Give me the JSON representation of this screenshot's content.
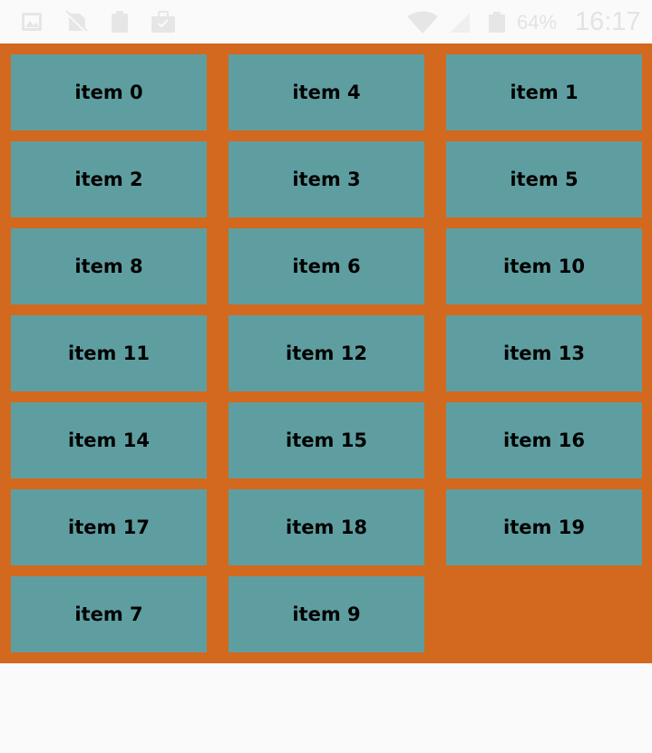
{
  "status_bar": {
    "icons_left": [
      "gallery-icon",
      "no-sim-icon",
      "clipboard-icon",
      "briefcase-icon"
    ],
    "icons_right": [
      "wifi-icon",
      "signal-icon",
      "battery-icon"
    ],
    "battery": "64%",
    "time": "16:17"
  },
  "colors": {
    "background": "#d2691e",
    "item": "#5f9ea0",
    "text": "#000000"
  },
  "items": [
    "item 0",
    "item 4",
    "item 1",
    "item 2",
    "item 3",
    "item 5",
    "item 8",
    "item 6",
    "item 10",
    "item 11",
    "item 12",
    "item 13",
    "item 14",
    "item 15",
    "item 16",
    "item 17",
    "item 18",
    "item 19",
    "item 7",
    "item 9"
  ]
}
